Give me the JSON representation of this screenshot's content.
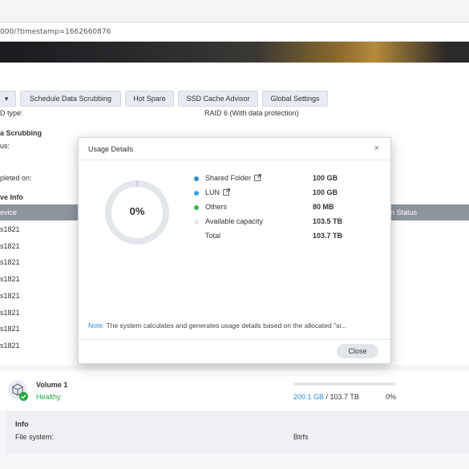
{
  "browser": {
    "url": "000/?timestamp=1662660876"
  },
  "toolbar": {
    "dropdown_label": "▾",
    "schedule_label": "Schedule Data Scrubbing",
    "hotspare_label": "Hot Spare",
    "ssd_label": "SSD Cache Advisor",
    "global_label": "Global Settings"
  },
  "background": {
    "raid_type_label": "D type:",
    "raid_type_value": "RAID 6 (With data protection)",
    "scrubbing_title": "a Scrubbing",
    "status_label": "us:",
    "completed_label": "pleted on:",
    "drive_info_title": "ve Info",
    "table_col_device": "evice",
    "table_col_status": "n Status",
    "rows": [
      "s1821",
      "s1821",
      "s1821",
      "s1821",
      "s1821",
      "s1821",
      "s1821",
      "s1821"
    ]
  },
  "modal": {
    "title": "Usage Details",
    "close_glyph": "×",
    "donut_percent": "0%",
    "used_fraction": 0.0,
    "legend": [
      {
        "name": "Shared Folder",
        "value": "100 GB",
        "color": "#2c8fd0",
        "external": true
      },
      {
        "name": "LUN",
        "value": "100 GB",
        "color": "#3aa0e0",
        "external": true
      },
      {
        "name": "Others",
        "value": "80 MB",
        "color": "#39b54a",
        "external": false
      },
      {
        "name": "Available capacity",
        "value": "103.5 TB",
        "color": "#e3e6ea",
        "external": false
      },
      {
        "name": "Total",
        "value": "103.7 TB",
        "color": "",
        "external": false
      }
    ],
    "note_key": "Note:",
    "note_text": " The system calculates and generates usage details based on the allocated \"si...",
    "close_button": "Close"
  },
  "volume": {
    "name": "Volume 1",
    "status": "Healthy",
    "used": "200.1 GB",
    "separator": " / ",
    "total": "103.7 TB",
    "percent": "0%",
    "progress_fraction": 0.0,
    "info_title": "Info",
    "fs_label": "File system:",
    "fs_value": "Btrfs"
  },
  "colors": {
    "accent": "#2c8fd0",
    "healthy": "#27a844",
    "table_header": "#8e949c"
  }
}
